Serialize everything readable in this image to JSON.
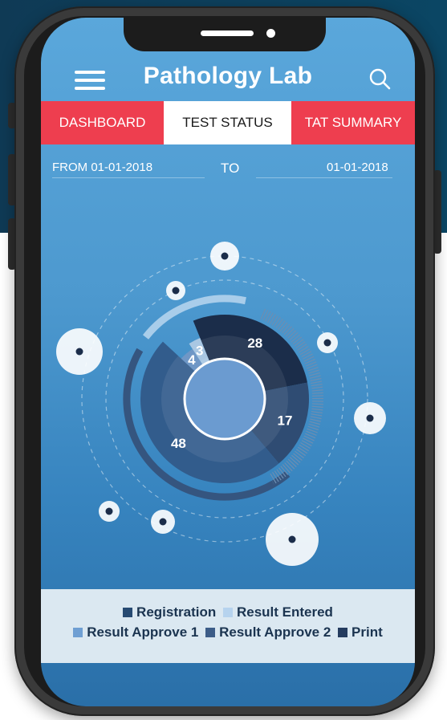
{
  "app": {
    "title": "Pathology Lab"
  },
  "header": {
    "menu_icon": "hamburger-menu-icon",
    "search_icon": "search-icon"
  },
  "tabs": [
    {
      "label": "DASHBOARD",
      "active": false
    },
    {
      "label": "TEST STATUS",
      "active": true
    },
    {
      "label": "TAT SUMMARY",
      "active": false
    }
  ],
  "date_range": {
    "from_label": "FROM 01-01-2018",
    "to_label": "TO",
    "to_value": "01-01-2018"
  },
  "chart_data": {
    "type": "pie",
    "values": [
      28,
      17,
      48,
      4,
      3
    ],
    "colors": [
      "#1b2d4a",
      "#2f4c73",
      "#325c8c",
      "#6f97c6",
      "#a9c7e3"
    ],
    "center_color": "#6b9bd0"
  },
  "legend": {
    "items": [
      {
        "label": "Registration",
        "color": "#274a72"
      },
      {
        "label": "Result Entered",
        "color": "#b6d3ee"
      },
      {
        "label": "Result Approve 1",
        "color": "#6f9fd3"
      },
      {
        "label": "Result Approve 2",
        "color": "#3d5d88"
      },
      {
        "label": "Print",
        "color": "#243c5f"
      }
    ]
  },
  "colors": {
    "tab_active_bg": "#ffffff",
    "tab_bg": "#ee3e4f",
    "screen_top": "#5aa7db",
    "legend_bg": "#dbe8f1"
  }
}
